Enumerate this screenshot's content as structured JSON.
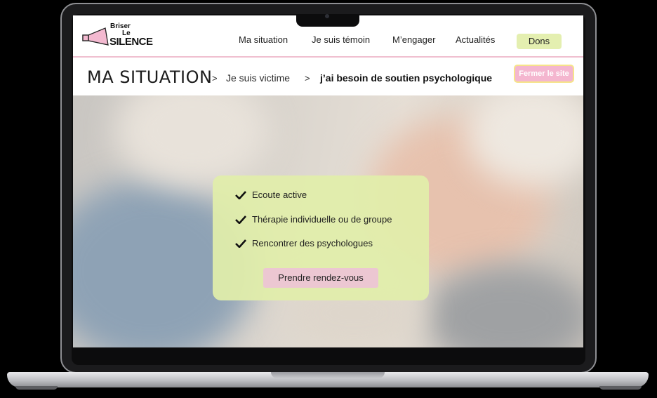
{
  "logo": {
    "line1": "Briser",
    "line2": "Le",
    "line3": "SILENCE"
  },
  "nav": {
    "items": [
      "Ma situation",
      "Je suis témoin",
      "M’engager",
      "Actualités"
    ],
    "donate": "Dons"
  },
  "breadcrumb": {
    "title": "MA SITUATION",
    "separator": ">",
    "level1": "Je suis victime",
    "level2": "j’ai besoin de soutien psychologique"
  },
  "close_site": "Fermer le site",
  "card": {
    "items": [
      "Ecoute active",
      "Thérapie individuelle ou de groupe",
      "Rencontrer des psychologues"
    ],
    "button": "Prendre rendez-vous"
  },
  "colors": {
    "accent_pink": "#f4b6cf",
    "accent_green": "#e4efb0",
    "card_green": "#e1eeaa",
    "button_pink": "#ecc7d2"
  }
}
